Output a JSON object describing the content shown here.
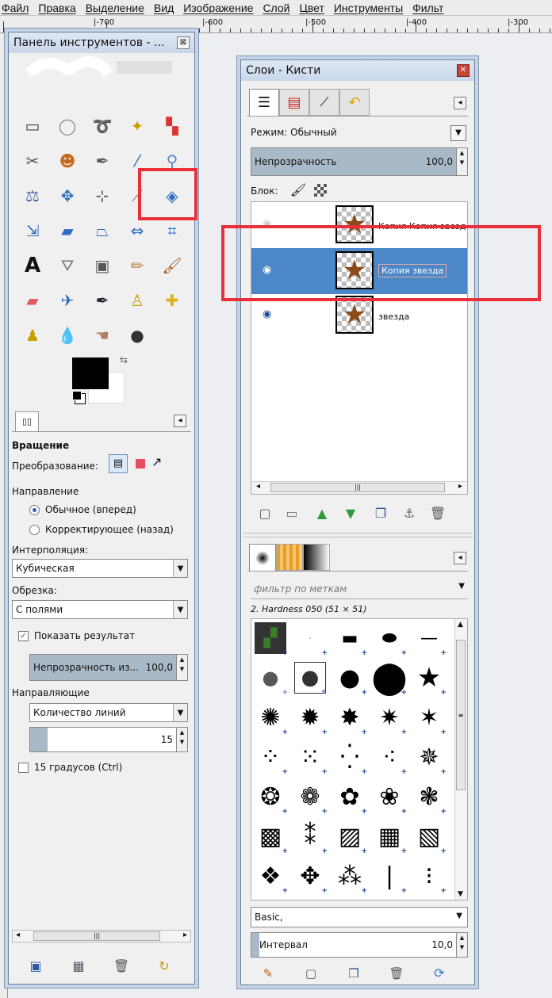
{
  "menu": [
    "Файл",
    "Правка",
    "Выделение",
    "Вид",
    "Изображение",
    "Слой",
    "Цвет",
    "Инструменты",
    "Фильт"
  ],
  "ruler": [
    "|-700",
    "|-600",
    "|-500",
    "|-400",
    "|-300"
  ],
  "toolbox": {
    "title": "Панель инструментов - ...",
    "tool_options": {
      "heading": "Вращение",
      "transform_label": "Преобразование:",
      "direction_label": "Направление",
      "direction_normal": "Обычное (вперед)",
      "direction_corrective": "Корректирующее (назад)",
      "interpolation_label": "Интерполяция:",
      "interpolation_value": "Кубическая",
      "clipping_label": "Обрезка:",
      "clipping_value": "С полями",
      "show_preview": "Показать результат",
      "preview_opacity_label": "Непрозрачность из...",
      "preview_opacity_value": "100,0",
      "guides_label": "Направляющие",
      "guides_value": "Количество линий",
      "lines_value": "15",
      "fifteen_degrees": "15 градусов  (Ctrl)"
    }
  },
  "layers": {
    "title": "Слои - Кисти",
    "mode_label": "Режим: Обычный",
    "opacity_label": "Непрозрачность",
    "opacity_value": "100,0",
    "lock_label": "Блок:",
    "rows": [
      {
        "name": "Копия Копия звезд"
      },
      {
        "name": "Копия звезда"
      },
      {
        "name": "звезда"
      }
    ]
  },
  "brushes": {
    "filter_placeholder": "фильтр по меткам",
    "selected_brush": "2. Hardness 050 (51 × 51)",
    "tag_value": "Basic,",
    "spacing_label": "Интервал",
    "spacing_value": "10,0"
  },
  "colors": {
    "highlight": "#e9303a",
    "selection": "#4c88c8"
  }
}
